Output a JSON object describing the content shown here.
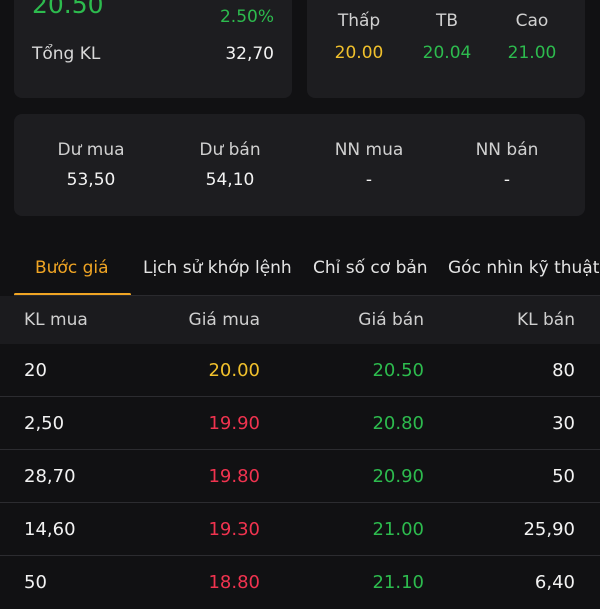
{
  "summary": {
    "price": "20.50",
    "change_pct": "2.50%",
    "volume_label": "Tổng KL",
    "volume_value": "32,70"
  },
  "range": {
    "low": {
      "label": "Thấp",
      "value": "20.00"
    },
    "avg": {
      "label": "TB",
      "value": "20.04"
    },
    "high": {
      "label": "Cao",
      "value": "21.00"
    }
  },
  "orders": {
    "buy_surplus": {
      "label": "Dư mua",
      "value": "53,50"
    },
    "sell_surplus": {
      "label": "Dư bán",
      "value": "54,10"
    },
    "foreign_buy": {
      "label": "NN mua",
      "value": "-"
    },
    "foreign_sell": {
      "label": "NN bán",
      "value": "-"
    }
  },
  "tabs": [
    {
      "label": "Bước giá",
      "active": true
    },
    {
      "label": "Lịch sử khớp lệnh",
      "active": false
    },
    {
      "label": "Chỉ số cơ bản",
      "active": false
    },
    {
      "label": "Góc nhìn kỹ thuật",
      "active": false
    }
  ],
  "table": {
    "headers": [
      "KL mua",
      "Giá mua",
      "Giá bán",
      "KL bán"
    ],
    "rows": [
      {
        "vol_buy": "20",
        "price_buy": "20.00",
        "price_buy_color": "#f0c02c",
        "price_sell": "20.50",
        "price_sell_color": "#2dbb4e",
        "vol_sell": "80"
      },
      {
        "vol_buy": "2,50",
        "price_buy": "19.90",
        "price_buy_color": "#f0334f",
        "price_sell": "20.80",
        "price_sell_color": "#2dbb4e",
        "vol_sell": "30"
      },
      {
        "vol_buy": "28,70",
        "price_buy": "19.80",
        "price_buy_color": "#f0334f",
        "price_sell": "20.90",
        "price_sell_color": "#2dbb4e",
        "vol_sell": "50"
      },
      {
        "vol_buy": "14,60",
        "price_buy": "19.30",
        "price_buy_color": "#f0334f",
        "price_sell": "21.00",
        "price_sell_color": "#2dbb4e",
        "vol_sell": "25,90"
      },
      {
        "vol_buy": "50",
        "price_buy": "18.80",
        "price_buy_color": "#f0334f",
        "price_sell": "21.10",
        "price_sell_color": "#2dbb4e",
        "vol_sell": "6,40"
      }
    ]
  },
  "colors": {
    "up": "#2dbb4e",
    "ref": "#f0c02c",
    "down": "#f0334f",
    "accent": "#f0a524"
  }
}
